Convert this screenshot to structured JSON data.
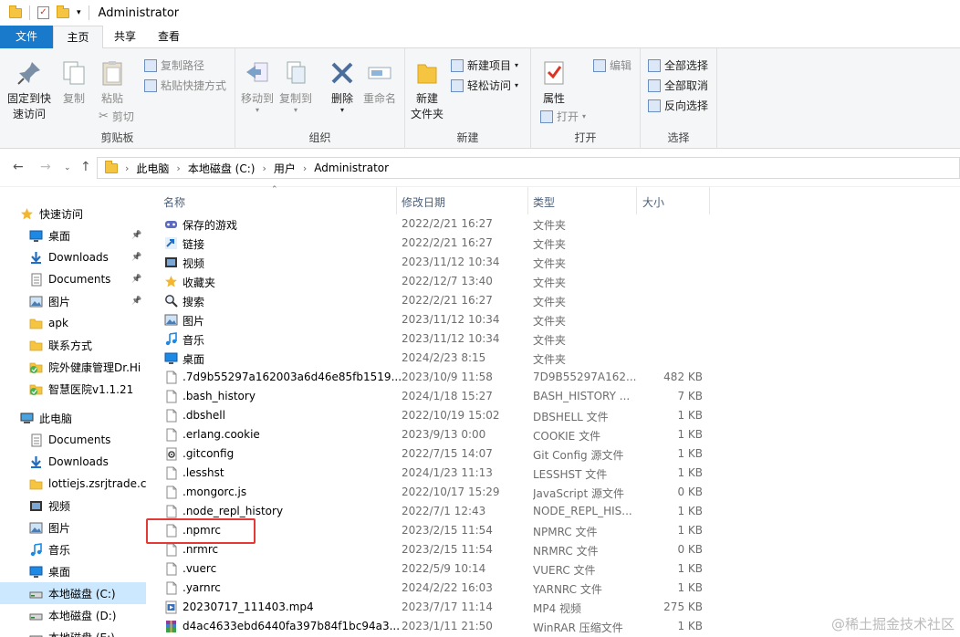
{
  "window": {
    "title": "Administrator"
  },
  "tabs": [
    "文件",
    "主页",
    "共享",
    "查看"
  ],
  "ribbon": {
    "clipboard": {
      "group_label": "剪贴板",
      "pin_label_1": "固定到快",
      "pin_label_2": "速访问",
      "copy": "复制",
      "paste": "粘贴",
      "copy_path": "复制路径",
      "paste_shortcut": "粘贴快捷方式",
      "cut": "剪切"
    },
    "organize": {
      "group_label": "组织",
      "move_to": "移动到",
      "copy_to": "复制到",
      "delete": "删除",
      "rename": "重命名"
    },
    "new": {
      "group_label": "新建",
      "new_folder_1": "新建",
      "new_folder_2": "文件夹",
      "new_item": "新建项目",
      "easy_access": "轻松访问"
    },
    "open": {
      "group_label": "打开",
      "properties": "属性",
      "open": "打开",
      "edit": "编辑"
    },
    "select": {
      "group_label": "选择",
      "select_all": "全部选择",
      "select_none": "全部取消",
      "invert": "反向选择"
    }
  },
  "address": {
    "crumbs": [
      "此电脑",
      "本地磁盘 (C:)",
      "用户",
      "Administrator"
    ]
  },
  "sidebar": {
    "items": [
      {
        "label": "快速访问",
        "icon": "star-icon",
        "pinned": false
      },
      {
        "label": "桌面",
        "icon": "desktop-icon",
        "pinned": true
      },
      {
        "label": "Downloads",
        "icon": "download-icon",
        "pinned": true
      },
      {
        "label": "Documents",
        "icon": "document-icon",
        "pinned": true
      },
      {
        "label": "图片",
        "icon": "pictures-icon",
        "pinned": true
      },
      {
        "label": "apk",
        "icon": "folder-icon",
        "pinned": false
      },
      {
        "label": "联系方式",
        "icon": "folder-icon",
        "pinned": false
      },
      {
        "label": "院外健康管理Dr.Hi",
        "icon": "folder-sync-icon",
        "pinned": false
      },
      {
        "label": "智慧医院v1.1.21",
        "icon": "folder-sync-icon",
        "pinned": false
      },
      {
        "label": "此电脑",
        "icon": "computer-icon",
        "pinned": false
      },
      {
        "label": "Documents",
        "icon": "document-icon",
        "pinned": false
      },
      {
        "label": "Downloads",
        "icon": "download-icon",
        "pinned": false
      },
      {
        "label": "lottiejs.zsrjtrade.cn",
        "icon": "folder-icon",
        "pinned": false
      },
      {
        "label": "视频",
        "icon": "video-icon",
        "pinned": false
      },
      {
        "label": "图片",
        "icon": "pictures-icon",
        "pinned": false
      },
      {
        "label": "音乐",
        "icon": "music-icon",
        "pinned": false
      },
      {
        "label": "桌面",
        "icon": "desktop-icon",
        "pinned": false
      },
      {
        "label": "本地磁盘 (C:)",
        "icon": "drive-icon",
        "pinned": false
      },
      {
        "label": "本地磁盘 (D:)",
        "icon": "drive-icon",
        "pinned": false
      },
      {
        "label": "本地磁盘 (E:)",
        "icon": "drive-icon",
        "pinned": false
      }
    ]
  },
  "columns": {
    "name": "名称",
    "date": "修改日期",
    "type": "类型",
    "size": "大小"
  },
  "files": [
    {
      "name": "保存的游戏",
      "date": "2022/2/21 16:27",
      "type": "文件夹",
      "size": "",
      "icon": "saved-games-icon"
    },
    {
      "name": "链接",
      "date": "2022/2/21 16:27",
      "type": "文件夹",
      "size": "",
      "icon": "links-icon"
    },
    {
      "name": "视频",
      "date": "2023/11/12 10:34",
      "type": "文件夹",
      "size": "",
      "icon": "video-icon"
    },
    {
      "name": "收藏夹",
      "date": "2022/12/7 13:40",
      "type": "文件夹",
      "size": "",
      "icon": "star-icon"
    },
    {
      "name": "搜索",
      "date": "2022/2/21 16:27",
      "type": "文件夹",
      "size": "",
      "icon": "search-icon"
    },
    {
      "name": "图片",
      "date": "2023/11/12 10:34",
      "type": "文件夹",
      "size": "",
      "icon": "pictures-icon"
    },
    {
      "name": "音乐",
      "date": "2023/11/12 10:34",
      "type": "文件夹",
      "size": "",
      "icon": "music-icon"
    },
    {
      "name": "桌面",
      "date": "2024/2/23 8:15",
      "type": "文件夹",
      "size": "",
      "icon": "desktop-icon"
    },
    {
      "name": ".7d9b55297a162003a6d46e85fb1519...",
      "date": "2023/10/9 11:58",
      "type": "7D9B55297A162...",
      "size": "482 KB",
      "icon": "file-icon"
    },
    {
      "name": ".bash_history",
      "date": "2024/1/18 15:27",
      "type": "BASH_HISTORY ...",
      "size": "7 KB",
      "icon": "file-icon"
    },
    {
      "name": ".dbshell",
      "date": "2022/10/19 15:02",
      "type": "DBSHELL 文件",
      "size": "1 KB",
      "icon": "file-icon"
    },
    {
      "name": ".erlang.cookie",
      "date": "2023/9/13 0:00",
      "type": "COOKIE 文件",
      "size": "1 KB",
      "icon": "file-icon"
    },
    {
      "name": ".gitconfig",
      "date": "2022/7/15 14:07",
      "type": "Git Config 源文件",
      "size": "1 KB",
      "icon": "gear-icon"
    },
    {
      "name": ".lesshst",
      "date": "2024/1/23 11:13",
      "type": "LESSHST 文件",
      "size": "1 KB",
      "icon": "file-icon"
    },
    {
      "name": ".mongorc.js",
      "date": "2022/10/17 15:29",
      "type": "JavaScript 源文件",
      "size": "0 KB",
      "icon": "file-icon"
    },
    {
      "name": ".node_repl_history",
      "date": "2022/7/1 12:43",
      "type": "NODE_REPL_HIS...",
      "size": "1 KB",
      "icon": "file-icon"
    },
    {
      "name": ".npmrc",
      "date": "2023/2/15 11:54",
      "type": "NPMRC 文件",
      "size": "1 KB",
      "icon": "file-icon"
    },
    {
      "name": ".nrmrc",
      "date": "2023/2/15 11:54",
      "type": "NRMRC 文件",
      "size": "0 KB",
      "icon": "file-icon"
    },
    {
      "name": ".vuerc",
      "date": "2022/5/9 10:14",
      "type": "VUERC 文件",
      "size": "1 KB",
      "icon": "file-icon"
    },
    {
      "name": ".yarnrc",
      "date": "2024/2/22 16:03",
      "type": "YARNRC 文件",
      "size": "1 KB",
      "icon": "file-icon"
    },
    {
      "name": "20230717_111403.mp4",
      "date": "2023/7/17 11:14",
      "type": "MP4 视频",
      "size": "275 KB",
      "icon": "video-file-icon"
    },
    {
      "name": "d4ac4633ebd6440fa397b84f1bc94a3...",
      "date": "2023/1/11 21:50",
      "type": "WinRAR 压缩文件",
      "size": "1 KB",
      "icon": "archive-icon"
    }
  ],
  "watermark": "@稀土掘金技术社区"
}
